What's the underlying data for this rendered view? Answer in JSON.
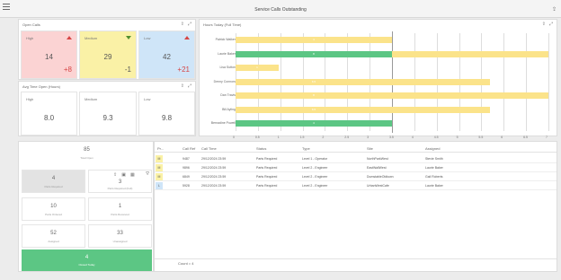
{
  "app": {
    "title": "Service Calls Outstanding"
  },
  "icons": {
    "menu": "hamburger-menu-icon",
    "export": "export-icon",
    "expand": "expand-icon",
    "filter": "filter-icon",
    "image": "image-icon",
    "grid": "grid-icon"
  },
  "colors": {
    "high": "#fbd3d3",
    "medium": "#faf1a6",
    "low": "#cfe5f8",
    "green": "#5cc684",
    "yellow": "#fbe38a"
  },
  "open_calls": {
    "title": "Open Calls",
    "tiles": [
      {
        "label": "High",
        "value": "14",
        "delta": "+8",
        "trend": "up"
      },
      {
        "label": "Medium",
        "value": "29",
        "delta": "-1",
        "trend": "down"
      },
      {
        "label": "Low",
        "value": "42",
        "delta": "+21",
        "trend": "up"
      }
    ]
  },
  "avg_time": {
    "title": "Avg Time Open (Hours)",
    "tiles": [
      {
        "label": "High",
        "value": "8.0"
      },
      {
        "label": "Medium",
        "value": "9.3"
      },
      {
        "label": "Low",
        "value": "9.8"
      }
    ]
  },
  "chart_data": {
    "type": "bar",
    "title": "Hours Today (Full Time)",
    "orientation": "horizontal",
    "categories": [
      "Patrick Walker",
      "Laurie Baker",
      "Lisa Sutton",
      "Denny Connors",
      "Dan Travis",
      "Bill Ayling",
      "Bernadine Powell"
    ],
    "series": [
      {
        "values": [
          4,
          8,
          1.1,
          6.5,
          8,
          6.5,
          4
        ]
      }
    ],
    "bar_labels": [
      "4",
      "8",
      "1",
      "6.5",
      "8",
      "6.5",
      "4"
    ],
    "bar_colors": [
      "yellow",
      "mixed",
      "yellow",
      "yellow",
      "yellow",
      "yellow",
      "green"
    ],
    "xlim": [
      0,
      8
    ],
    "xticks": [
      "0",
      "0.5",
      "1",
      "1.5",
      "2",
      "2.5",
      "3",
      "3.5",
      "4",
      "4.5",
      "5",
      "5.5",
      "6",
      "6.5",
      "7"
    ],
    "reference_line": 4
  },
  "stats": {
    "total": {
      "value": "85",
      "label": "Total Open"
    },
    "cells": [
      {
        "value": "4",
        "label": "Parts Required"
      },
      {
        "value": "3",
        "label": "Parts Required (Full)"
      },
      {
        "value": "10",
        "label": "Parts Ordered"
      },
      {
        "value": "1",
        "label": "Parts Received"
      },
      {
        "value": "52",
        "label": "Assigned"
      },
      {
        "value": "33",
        "label": "Unassigned"
      }
    ],
    "closed": {
      "value": "4",
      "label": "Closed Today"
    }
  },
  "table": {
    "columns": [
      "Pr...",
      "Call Ref",
      "Call Time",
      "Status",
      "Type",
      "Site",
      "Assigned"
    ],
    "rows": [
      {
        "priority": "M",
        "priority_color": "medium",
        "ref": "9487",
        "time": "29/12/2024 23:59",
        "status": "Parts Required",
        "type": "Level 1 - Operator",
        "site": "NorthParkWest",
        "assigned": "Stevie Smith"
      },
      {
        "priority": "M",
        "priority_color": "medium",
        "ref": "9896",
        "time": "29/12/2024 23:59",
        "status": "Parts Required",
        "type": "Level 2 - Engineer",
        "site": "EastWallWest",
        "assigned": "Laurie Baker"
      },
      {
        "priority": "M",
        "priority_color": "medium",
        "ref": "6849",
        "time": "29/12/2024 23:59",
        "status": "Parts Required",
        "type": "Level 2 - Engineer",
        "site": "DumstableOldtown",
        "assigned": "Gail Roberts"
      },
      {
        "priority": "L",
        "priority_color": "low",
        "ref": "5928",
        "time": "29/12/2024 23:59",
        "status": "Parts Required",
        "type": "Level 2 - Engineer",
        "site": "UrbanWestCafe",
        "assigned": "Laurie Baker"
      }
    ],
    "count": "Count = 4"
  }
}
